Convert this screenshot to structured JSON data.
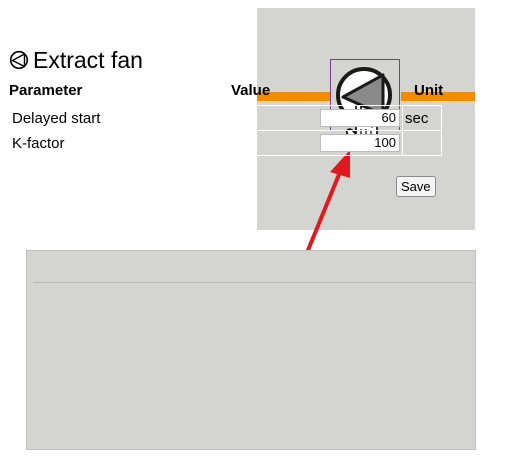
{
  "panel": {
    "title": "Extract fan",
    "title_icon": "fan-icon",
    "headers": {
      "parameter": "Parameter",
      "value": "Value",
      "unit": "Unit"
    },
    "rows": [
      {
        "name": "Delayed start",
        "value": "60",
        "unit": "sec"
      },
      {
        "name": "K-factor",
        "value": "100",
        "unit": ""
      }
    ],
    "save_label": "Save"
  },
  "diagram": {
    "pipe_color": "#f08c00",
    "selection_color": "#7a3f8f",
    "symbol": "fan-icon",
    "cursor": "hand-pointer-icon"
  },
  "connector": {
    "color": "#e0191e",
    "icon": "double-arrow-icon"
  }
}
